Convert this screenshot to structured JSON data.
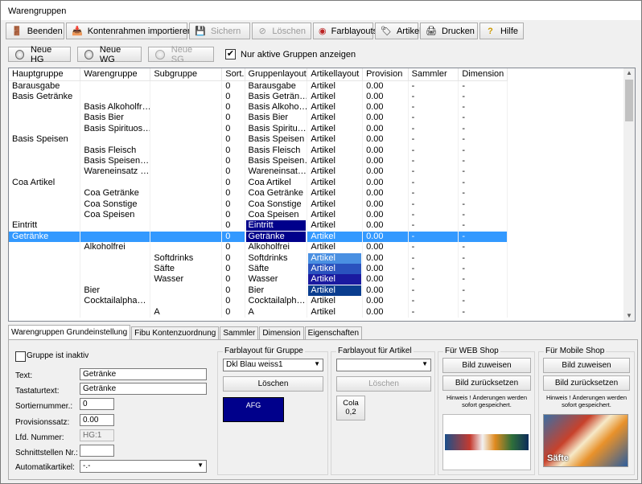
{
  "window": {
    "title": "Warengruppen"
  },
  "toolbar": {
    "buttons": [
      {
        "label": "Beenden",
        "icon": "exit-icon",
        "disabled": false,
        "mnemonic": true
      },
      {
        "label": "Kontenrahmen importieren",
        "icon": "import-icon",
        "disabled": false
      },
      {
        "label": "Sichern",
        "icon": "save-icon",
        "disabled": true
      },
      {
        "label": "Löschen",
        "icon": "delete-icon",
        "disabled": true
      },
      {
        "label": "Farblayouts",
        "icon": "color-layout-icon",
        "disabled": false
      },
      {
        "label": "Artikel",
        "icon": "article-icon",
        "disabled": false
      },
      {
        "label": "Drucken",
        "icon": "print-icon",
        "disabled": false
      },
      {
        "label": "Hilfe",
        "icon": "help-icon",
        "disabled": false
      }
    ]
  },
  "actions": {
    "new_hg": "Neue HG",
    "new_wg": "Neue WG",
    "new_sg": "Neue SG",
    "only_active_label": "Nur aktive Gruppen anzeigen",
    "only_active_checked": true
  },
  "grid": {
    "columns": [
      "Hauptgruppe",
      "Warengruppe",
      "Subgruppe",
      "Sort.",
      "Gruppenlayout",
      "Artikellayout",
      "Provision",
      "Sammler",
      "Dimension"
    ],
    "rows": [
      [
        "Barausgabe",
        "",
        "",
        "0",
        "Barausgabe",
        "Artikel",
        "0.00",
        "-",
        "-"
      ],
      [
        "Basis Getränke",
        "",
        "",
        "0",
        "Basis Geträn…",
        "Artikel",
        "0.00",
        "-",
        "-"
      ],
      [
        "",
        "Basis Alkoholfr…",
        "",
        "0",
        "Basis Alkoho…",
        "Artikel",
        "0.00",
        "-",
        "-"
      ],
      [
        "",
        "Basis Bier",
        "",
        "0",
        "Basis Bier",
        "Artikel",
        "0.00",
        "-",
        "-"
      ],
      [
        "",
        "Basis Spirituos…",
        "",
        "0",
        "Basis Spiritu…",
        "Artikel",
        "0.00",
        "-",
        "-"
      ],
      [
        "Basis Speisen",
        "",
        "",
        "0",
        "Basis Speisen",
        "Artikel",
        "0.00",
        "-",
        "-"
      ],
      [
        "",
        "Basis Fleisch",
        "",
        "0",
        "Basis Fleisch",
        "Artikel",
        "0.00",
        "-",
        "-"
      ],
      [
        "",
        "Basis Speisen…",
        "",
        "0",
        "Basis Speisen…",
        "Artikel",
        "0.00",
        "-",
        "-"
      ],
      [
        "",
        "Wareneinsatz …",
        "",
        "0",
        "Wareneinsat…",
        "Artikel",
        "0.00",
        "-",
        "-"
      ],
      [
        "Coa Artikel",
        "",
        "",
        "0",
        "Coa Artikel",
        "Artikel",
        "0.00",
        "-",
        "-"
      ],
      [
        "",
        "Coa Getränke",
        "",
        "0",
        "Coa Getränke",
        "Artikel",
        "0.00",
        "-",
        "-"
      ],
      [
        "",
        "Coa Sonstige",
        "",
        "0",
        "Coa Sonstige",
        "Artikel",
        "0.00",
        "-",
        "-"
      ],
      [
        "",
        "Coa Speisen",
        "",
        "0",
        "Coa Speisen",
        "Artikel",
        "0.00",
        "-",
        "-"
      ],
      [
        "Eintritt",
        "",
        "",
        "0",
        "Eintritt",
        "Artikel",
        "0.00",
        "-",
        "-"
      ],
      [
        "Getränke",
        "",
        "",
        "0",
        "Getränke",
        "Artikel",
        "0.00",
        "-",
        "-"
      ],
      [
        "",
        "Alkoholfrei",
        "",
        "0",
        "Alkoholfrei",
        "Artikel",
        "0.00",
        "-",
        "-"
      ],
      [
        "",
        "",
        "Softdrinks",
        "0",
        "Softdrinks",
        "Artikel",
        "0.00",
        "-",
        "-"
      ],
      [
        "",
        "",
        "Säfte",
        "0",
        "Säfte",
        "Artikel",
        "0.00",
        "-",
        "-"
      ],
      [
        "",
        "",
        "Wasser",
        "0",
        "Wasser",
        "Artikel",
        "0.00",
        "-",
        "-"
      ],
      [
        "",
        "Bier",
        "",
        "0",
        "Bier",
        "Artikel",
        "0.00",
        "-",
        "-"
      ],
      [
        "",
        "Cocktailalpha…",
        "",
        "0",
        "Cocktailalph…",
        "Artikel",
        "0.00",
        "-",
        "-"
      ],
      [
        "",
        "",
        "A",
        "0",
        "A",
        "Artikel",
        "0.00",
        "-",
        "-"
      ]
    ],
    "selected_row": 14,
    "cell_colors": {
      "13-4": "#00008b",
      "14-4": "#00008b",
      "17-5": "#2a52be",
      "18-5": "#1a1aa0",
      "19-5": "#0a3d8f",
      "16-5": "#4a90e2"
    }
  },
  "tabs": [
    "Warengruppen Grundeinstellung",
    "Fibu Kontenzuordnung",
    "Sammler",
    "Dimension",
    "Eigenschaften"
  ],
  "form": {
    "inactive_label": "Gruppe ist inaktiv",
    "text_label": "Text:",
    "text_value": "Getränke",
    "tastatur_label": "Tastaturtext:",
    "tastatur_value": "Getränke",
    "sort_label": "Sortiernummer.:",
    "sort_value": "0",
    "prov_label": "Provisionssatz:",
    "prov_value": "0.00",
    "lfd_label": "Lfd. Nummer:",
    "lfd_value": "HG:1",
    "schnitt_label": "Schnittstellen Nr.:",
    "schnitt_value": "",
    "auto_label": "Automatikartikel:",
    "auto_value": "-.-"
  },
  "farb_gruppe": {
    "title": "Farblayout für Gruppe",
    "selected": "Dkl Blau weiss1",
    "delete": "Löschen",
    "preview_text": "AFG",
    "preview_color": "#00008b"
  },
  "farb_artikel": {
    "title": "Farblayout für Artikel",
    "selected": "",
    "delete": "Löschen",
    "preview_text": "Cola\n0,2"
  },
  "web_shop": {
    "title": "Für WEB Shop",
    "assign": "Bild zuweisen",
    "reset": "Bild zurücksetzen",
    "note": "Hinweis ! Änderungen werden sofort gespeichert."
  },
  "mobile_shop": {
    "title": "Für Mobile Shop",
    "assign": "Bild zuweisen",
    "reset": "Bild zurücksetzen",
    "note": "Hinweis ! Änderungen werden sofort gespeichert.",
    "image_caption": "Säfte"
  }
}
